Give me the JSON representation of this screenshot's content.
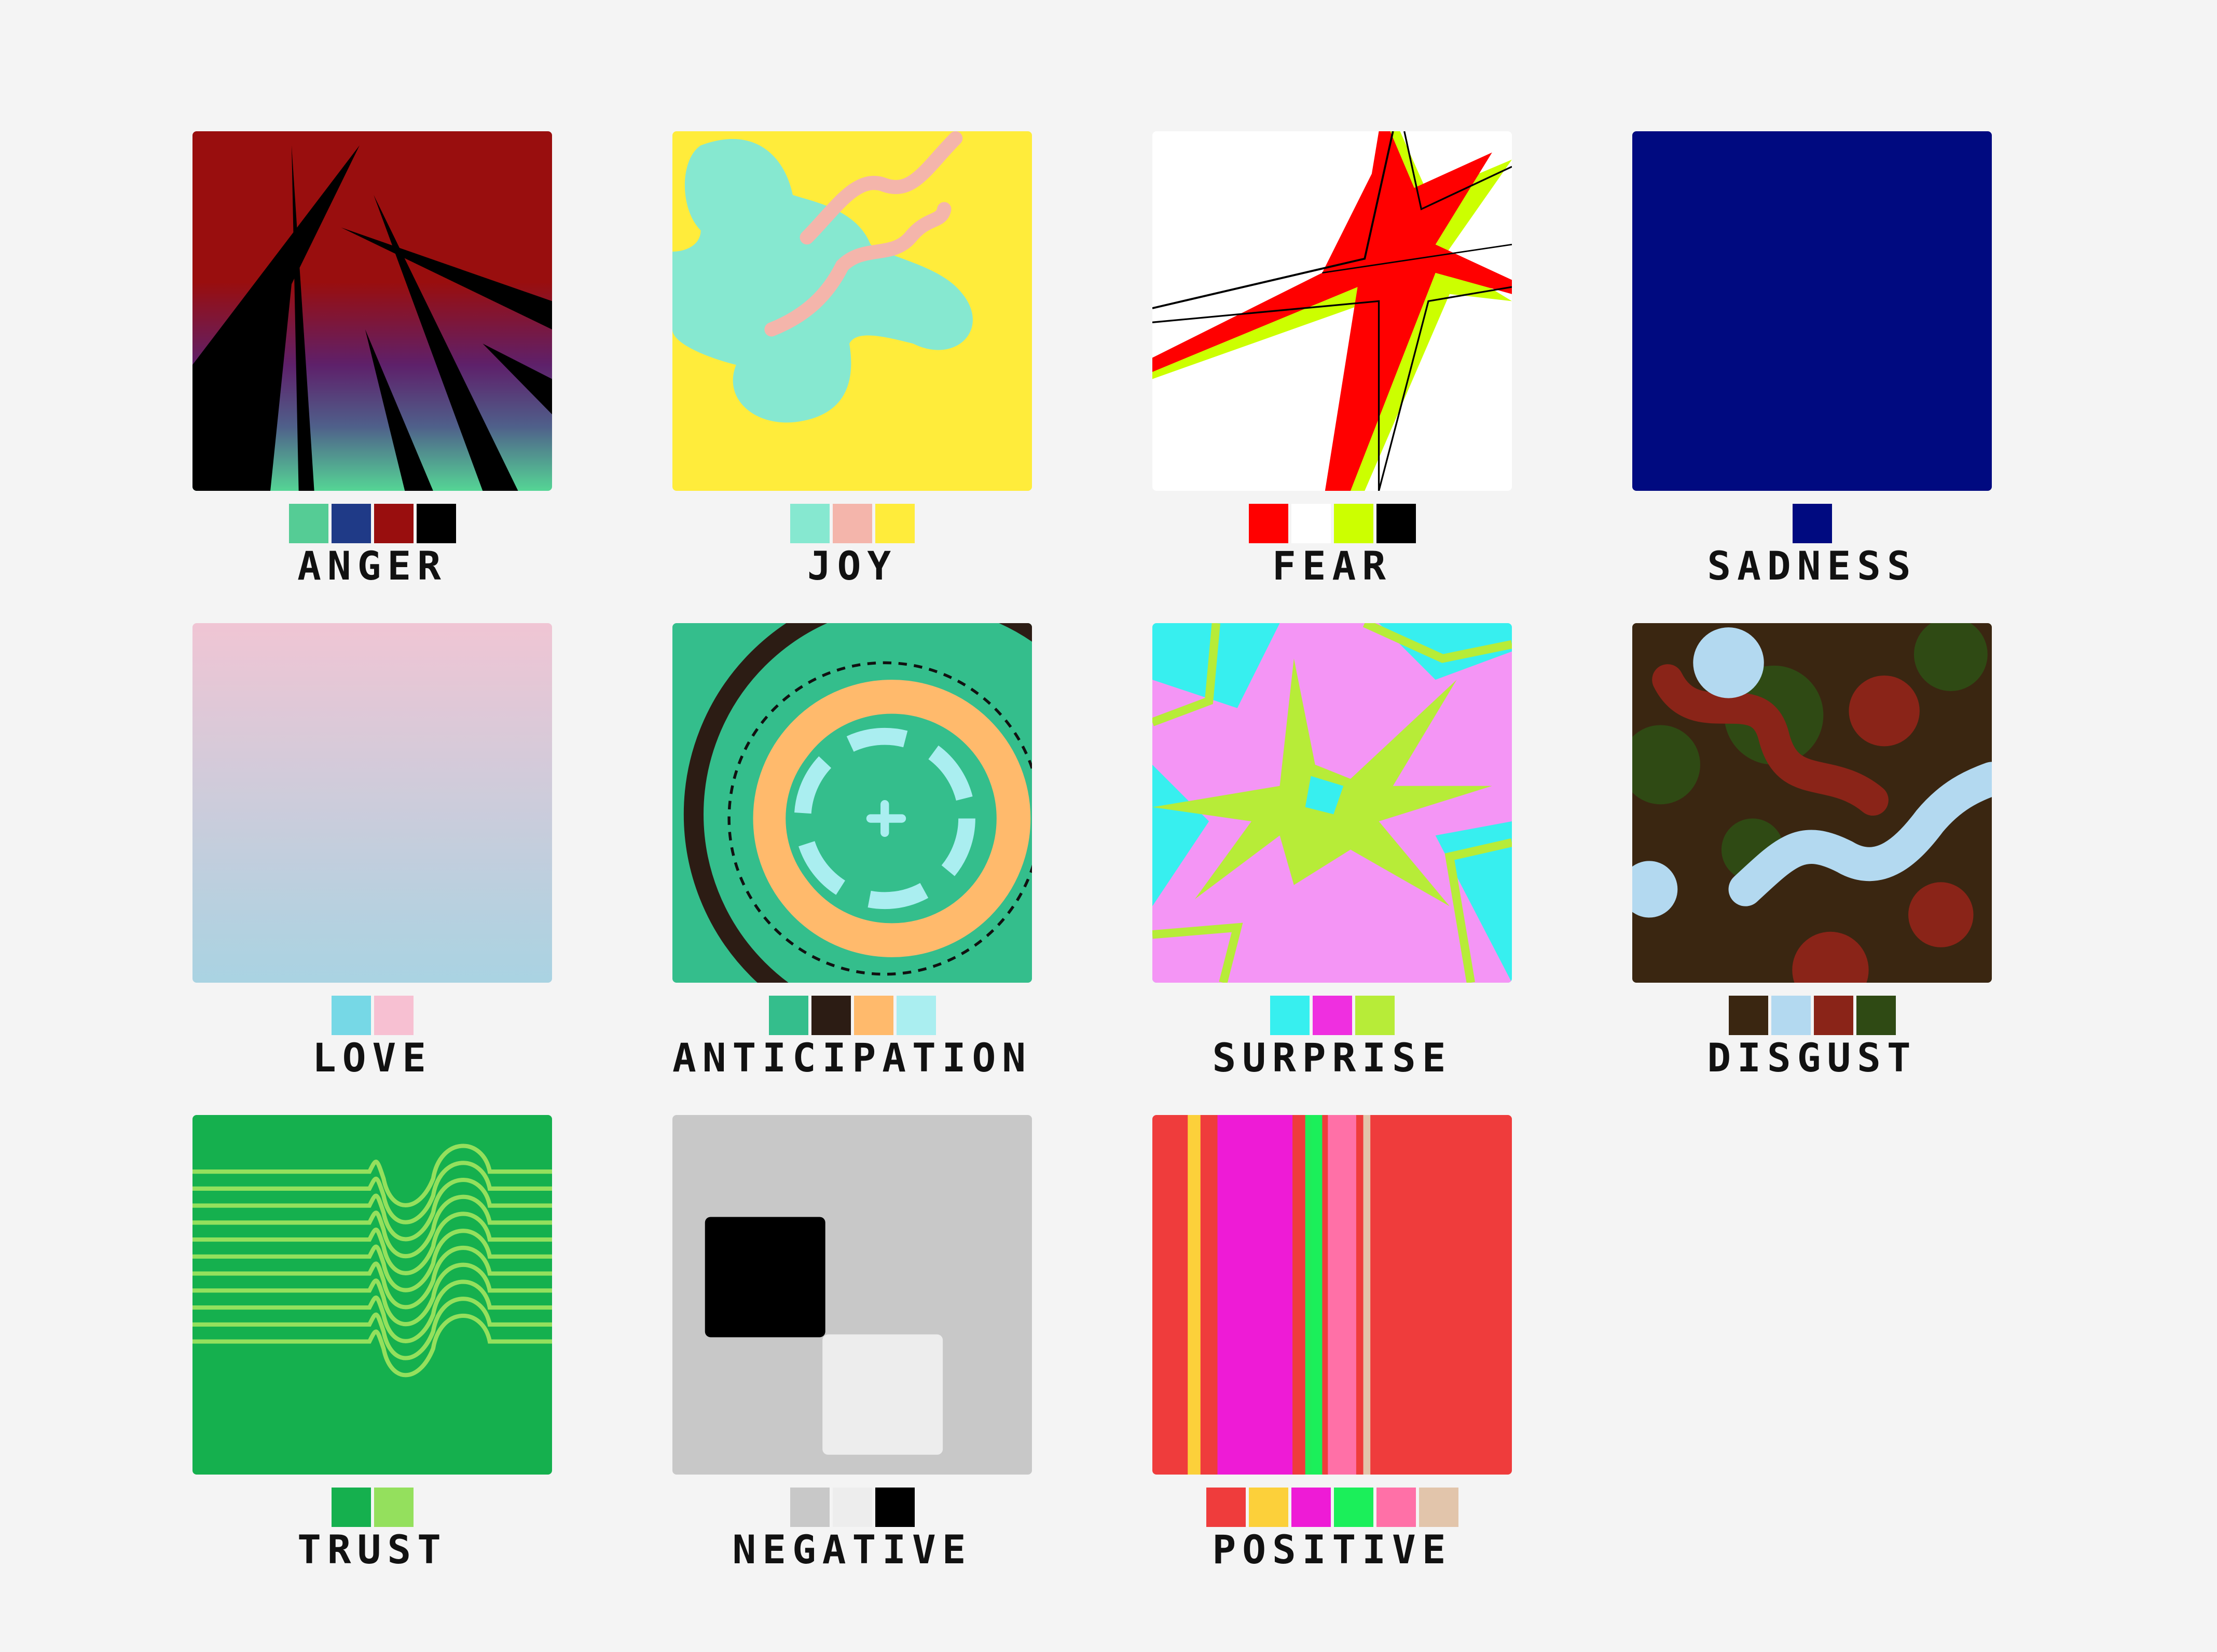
{
  "emotions": [
    {
      "key": "anger",
      "label": "ANGER",
      "palette": [
        "#55cc95",
        "#1f3a87",
        "#990e0e",
        "#000000"
      ]
    },
    {
      "key": "joy",
      "label": "JOY",
      "palette": [
        "#86e8d0",
        "#f4b5ab",
        "#ffec3b"
      ]
    },
    {
      "key": "fear",
      "label": "FEAR",
      "palette": [
        "#ff0000",
        "#ffffff",
        "#ccff00",
        "#000000"
      ]
    },
    {
      "key": "sadness",
      "label": "SADNESS",
      "palette": [
        "#000a80"
      ]
    },
    {
      "key": "love",
      "label": "LOVE",
      "palette": [
        "#76d8e6",
        "#f7c0d2"
      ]
    },
    {
      "key": "anticipation",
      "label": "ANTICIPATION",
      "palette": [
        "#34be8c",
        "#2c1c14",
        "#ffba6c",
        "#aaeef0"
      ]
    },
    {
      "key": "surprise",
      "label": "SURPRISE",
      "palette": [
        "#37efef",
        "#ef2fe0",
        "#b7ec38"
      ]
    },
    {
      "key": "disgust",
      "label": "DISGUST",
      "palette": [
        "#3a2611",
        "#b3d9f0",
        "#8a2418",
        "#2f4a14"
      ]
    },
    {
      "key": "trust",
      "label": "TRUST",
      "palette": [
        "#15b04e",
        "#94e05d"
      ]
    },
    {
      "key": "negative",
      "label": "NEGATIVE",
      "palette": [
        "#c8c8c8",
        "#ededed",
        "#000000"
      ]
    },
    {
      "key": "positive",
      "label": "POSITIVE",
      "palette": [
        "#ef3c3c",
        "#fcd03a",
        "#ee1bd6",
        "#1bef5a",
        "#ff70a7",
        "#e2c5ab"
      ]
    }
  ]
}
